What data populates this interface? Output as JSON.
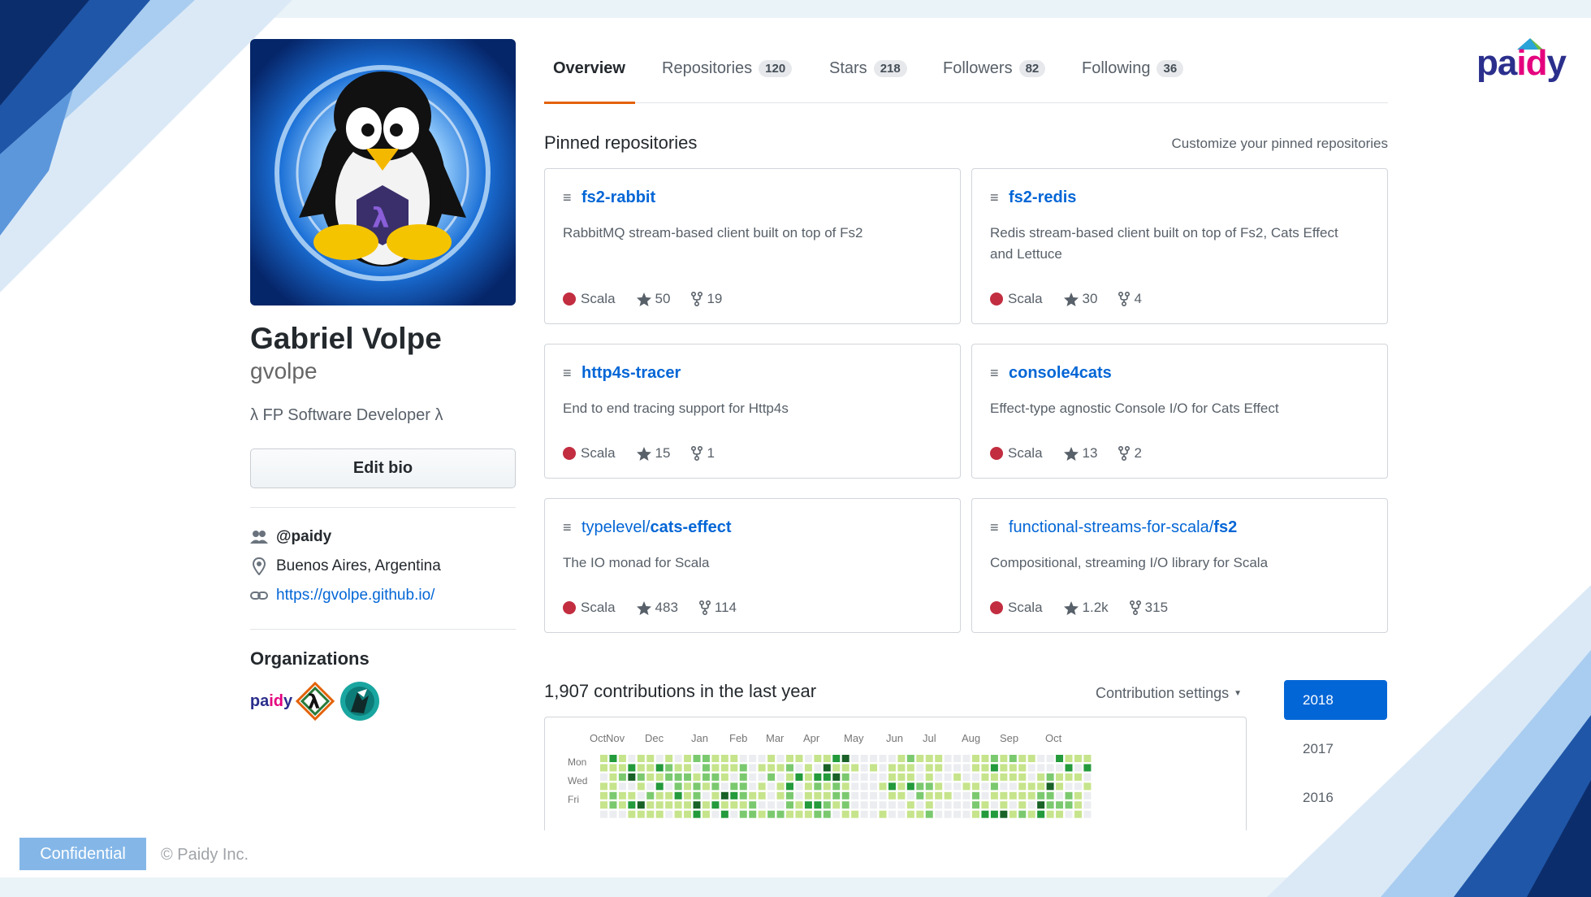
{
  "profile": {
    "name": "Gabriel Volpe",
    "login": "gvolpe",
    "bio": "λ FP Software Developer λ",
    "edit_bio_label": "Edit bio",
    "company": "@paidy",
    "location": "Buenos Aires, Argentina",
    "website": "https://gvolpe.github.io/",
    "organizations_title": "Organizations",
    "organizations": [
      {
        "name": "paidy",
        "label": "paidy"
      },
      {
        "name": "lambda-org",
        "label": "λ"
      },
      {
        "name": "teal-org",
        "label": ""
      }
    ]
  },
  "tabs": [
    {
      "label": "Overview",
      "count": ""
    },
    {
      "label": "Repositories",
      "count": "120"
    },
    {
      "label": "Stars",
      "count": "218"
    },
    {
      "label": "Followers",
      "count": "82"
    },
    {
      "label": "Following",
      "count": "36"
    }
  ],
  "pinned": {
    "title": "Pinned repositories",
    "customize_label": "Customize your pinned repositories",
    "repos": [
      {
        "owner": "",
        "name": "fs2-rabbit",
        "description": "RabbitMQ stream-based client built on top of Fs2",
        "language": "Scala",
        "stars": "50",
        "forks": "19"
      },
      {
        "owner": "",
        "name": "fs2-redis",
        "description": "Redis stream-based client built on top of Fs2, Cats Effect and Lettuce",
        "language": "Scala",
        "stars": "30",
        "forks": "4"
      },
      {
        "owner": "",
        "name": "http4s-tracer",
        "description": "End to end tracing support for Http4s",
        "language": "Scala",
        "stars": "15",
        "forks": "1"
      },
      {
        "owner": "",
        "name": "console4cats",
        "description": "Effect-type agnostic Console I/O for Cats Effect",
        "language": "Scala",
        "stars": "13",
        "forks": "2"
      },
      {
        "owner": "typelevel/",
        "name": "cats-effect",
        "description": "The IO monad for Scala",
        "language": "Scala",
        "stars": "483",
        "forks": "114"
      },
      {
        "owner": "functional-streams-for-scala/",
        "name": "fs2",
        "description": "Compositional, streaming I/O library for Scala",
        "language": "Scala",
        "stars": "1.2k",
        "forks": "315"
      }
    ]
  },
  "contributions": {
    "title": "1,907 contributions in the last year",
    "settings_label": "Contribution settings",
    "months": [
      "Oct",
      "Nov",
      "Dec",
      "Jan",
      "Feb",
      "Mar",
      "Apr",
      "May",
      "Jun",
      "Jul",
      "Aug",
      "Sep",
      "Oct"
    ],
    "days": [
      "Mon",
      "Wed",
      "Fri"
    ],
    "colors": [
      "#ebedf0",
      "#c6e48b",
      "#7bc96f",
      "#239a3b",
      "#196127"
    ]
  },
  "years": [
    "2018",
    "2017",
    "2016"
  ],
  "footer": {
    "confidential": "Confidential",
    "copyright": "© Paidy Inc."
  },
  "brand": {
    "logo_pre": "pa",
    "logo_mid": "id",
    "logo_post": "y",
    "primary": "#2b2f8c",
    "accent": "#e5007e"
  }
}
